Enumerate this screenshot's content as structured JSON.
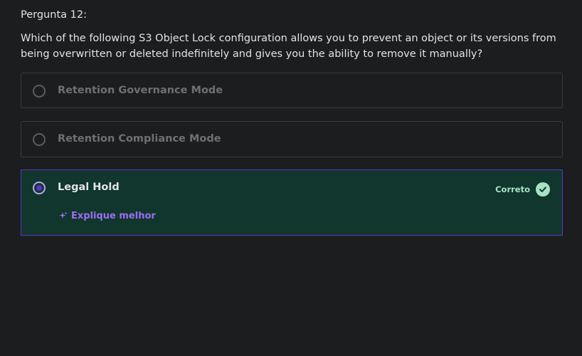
{
  "question": {
    "label": "Pergunta 12:",
    "text": "Which of the following S3 Object Lock configuration allows you to prevent an object or its versions from being overwritten or deleted indefinitely and gives you the ability to remove it manually?"
  },
  "options": [
    {
      "label": "Retention Governance Mode",
      "selected": false
    },
    {
      "label": "Retention Compliance Mode",
      "selected": false
    },
    {
      "label": "Legal Hold",
      "selected": true,
      "status": "Correto",
      "explain_label": "Explique melhor"
    }
  ],
  "colors": {
    "background": "#1c1d1f",
    "selected_bg": "#10362d",
    "accent": "#5b34c9",
    "correct": "#a6e3c5",
    "explain": "#9b6ef2"
  },
  "icons": [
    "check-circle-icon",
    "sparkle-icon"
  ]
}
